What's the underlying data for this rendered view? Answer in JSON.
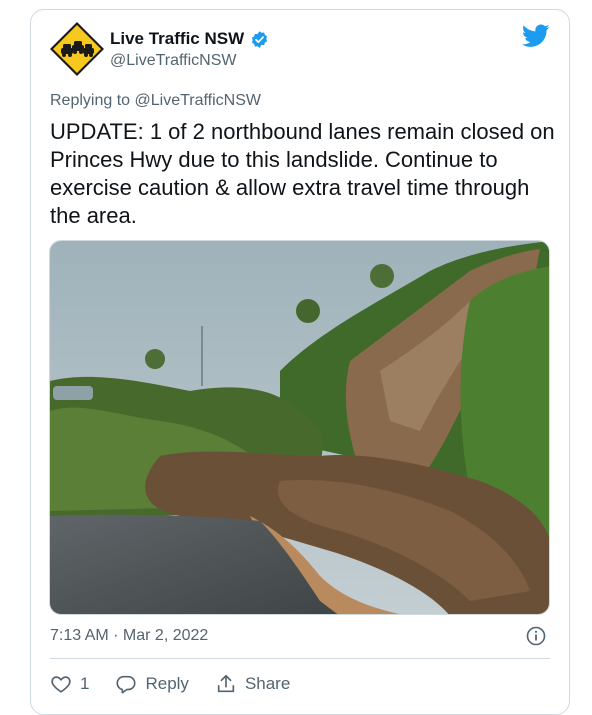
{
  "tweet": {
    "display_name": "Live Traffic NSW",
    "handle": "@LiveTrafficNSW",
    "replying_prefix": "Replying to ",
    "replying_to": "@LiveTrafficNSW",
    "text": "UPDATE: 1 of 2 northbound lanes remain closed on Princes Hwy due to this landslide. Continue to exercise caution & allow extra travel time through the area.",
    "timestamp": "7:13 AM · Mar 2, 2022",
    "like_count": "1",
    "reply_label": "Reply",
    "share_label": "Share"
  },
  "icons": {
    "avatar": "road-sign-cars-icon",
    "verified": "verified-badge-icon",
    "brand": "twitter-bird-icon",
    "info": "info-icon",
    "like": "heart-icon",
    "reply": "speech-bubble-icon",
    "share": "share-upload-icon"
  },
  "colors": {
    "brand_blue": "#1d9bf0",
    "text": "#0f1419",
    "secondary": "#536471",
    "sign_yellow": "#f7c81e"
  }
}
